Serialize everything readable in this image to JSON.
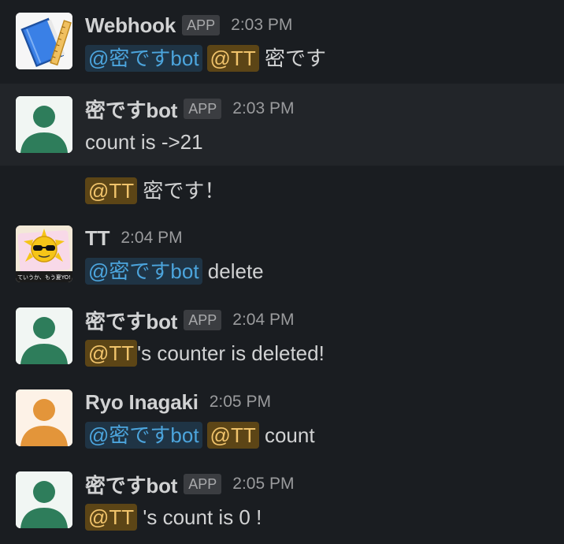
{
  "messages": [
    {
      "name": "Webhook",
      "badge": "APP",
      "time": "2:03 PM",
      "mention_bot": "@密ですbot",
      "mention_user": "@TT",
      "text": "密です"
    },
    {
      "name": "密ですbot",
      "badge": "APP",
      "time": "2:03 PM",
      "text": "count is ->21"
    },
    {
      "mention_user": "@TT",
      "text": "密です！"
    },
    {
      "name": "TT",
      "time": "2:04 PM",
      "mention_bot": "@密ですbot",
      "text": "delete",
      "avatar_caption": "ていうか、もう夏YO!"
    },
    {
      "name": "密ですbot",
      "badge": "APP",
      "time": "2:04 PM",
      "mention_user": "@TT",
      "text": "'s counter is deleted!"
    },
    {
      "name": "Ryo Inagaki",
      "time": "2:05 PM",
      "mention_bot": "@密ですbot",
      "mention_user": "@TT",
      "text": "count"
    },
    {
      "name": "密ですbot",
      "badge": "APP",
      "time": "2:05 PM",
      "mention_user": "@TT",
      "text": "'s count is 0 !"
    }
  ],
  "colors": {
    "background": "#1a1d21",
    "hover_row": "#222529",
    "bot_mention": "#4ca5dd",
    "user_mention": "#f0c36b",
    "bot_avatar": "#2e7d5b",
    "ryo_avatar": "#e3953a"
  },
  "icons": {
    "webhook_avatar": "book-ruler-icon",
    "bot_avatar": "default-user-icon",
    "tt_avatar": "sun-sunglasses-icon",
    "ryo_avatar": "default-user-icon"
  }
}
